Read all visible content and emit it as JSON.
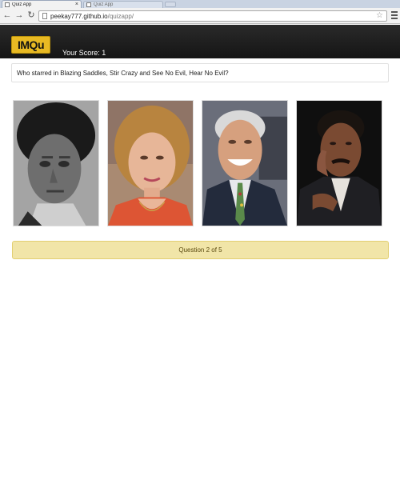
{
  "browser": {
    "tabs": [
      {
        "title": "Quiz App",
        "active": true
      },
      {
        "title": "Quiz App",
        "active": false
      }
    ],
    "url_host": "peekay777.github.io",
    "url_path": "/quizapp/"
  },
  "app": {
    "logo_text": "IMQu",
    "score_label": "Your Score:",
    "score_value": "1",
    "question": "Who starred in Blazing Saddles, Stir Crazy and See No Evil, Hear No Evil?",
    "progress_text": "Question 2 of 5"
  },
  "colors": {
    "logo": "#e8b923",
    "header": "#1e1e1e",
    "progress": "#f1e5a8"
  }
}
